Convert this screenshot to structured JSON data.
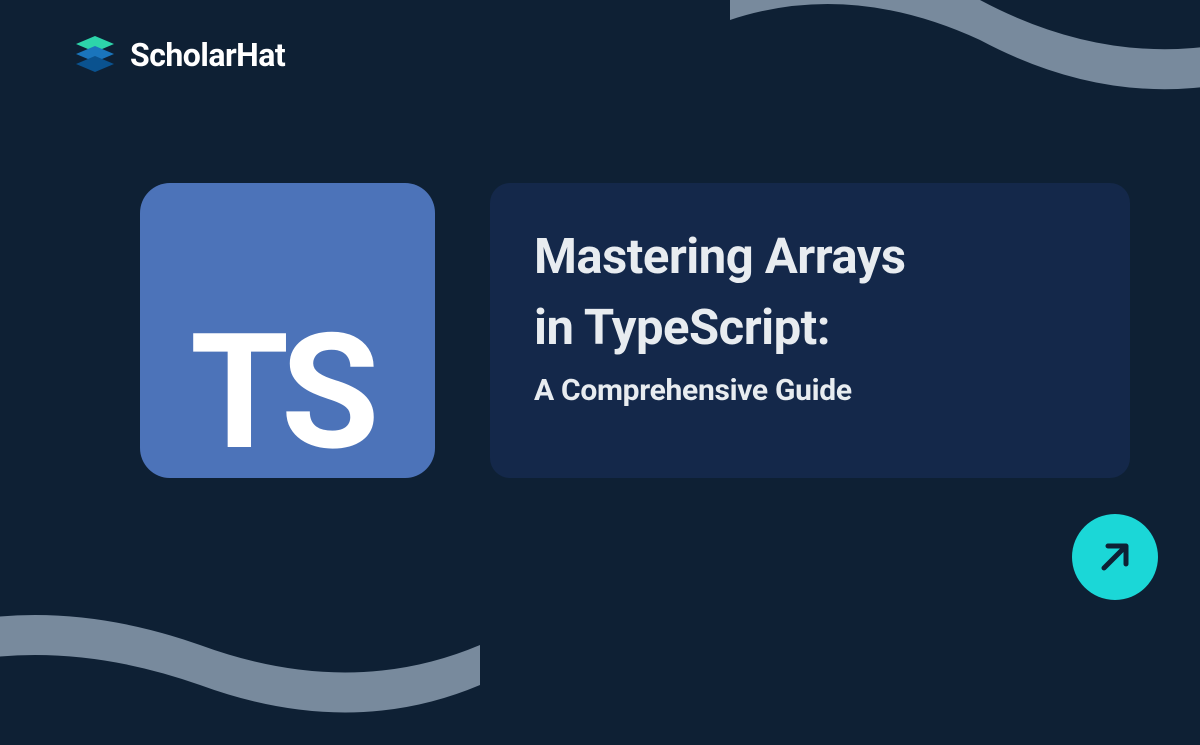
{
  "brand": {
    "name": "ScholarHat"
  },
  "badge": {
    "text": "TS"
  },
  "content": {
    "title_line1": "Mastering Arrays",
    "title_line2": "in TypeScript:",
    "subtitle": "A Comprehensive Guide"
  },
  "colors": {
    "background": "#0e2034",
    "curve": "#788a9d",
    "badge_bg": "#4c73b9",
    "content_bg": "#14284a",
    "accent": "#1bd7d7",
    "brand_icon_top": "#2dd4aa",
    "brand_icon_mid": "#1a75bc",
    "brand_icon_bottom": "#0a528f"
  }
}
